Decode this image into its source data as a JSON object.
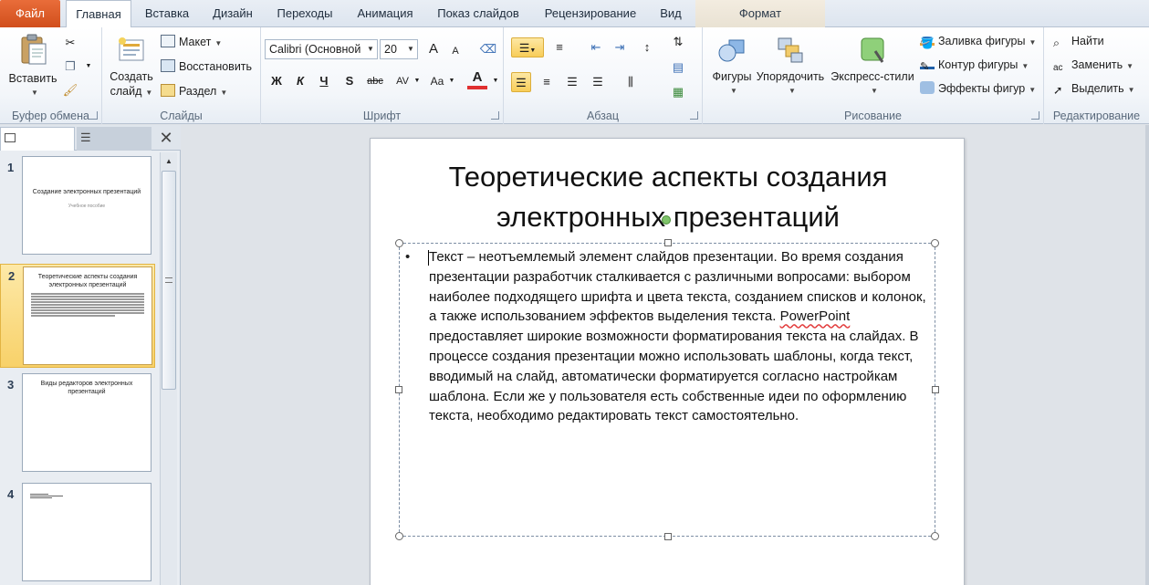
{
  "tabs": {
    "file": "Файл",
    "home": "Главная",
    "insert": "Вставка",
    "design": "Дизайн",
    "transitions": "Переходы",
    "animation": "Анимация",
    "slideshow": "Показ слайдов",
    "review": "Рецензирование",
    "view": "Вид",
    "format": "Формат"
  },
  "clipboard": {
    "paste": "Вставить",
    "group_label": "Буфер обмена"
  },
  "slides_group": {
    "new_slide_line1": "Создать",
    "new_slide_line2": "слайд",
    "layout": "Макет",
    "reset": "Восстановить",
    "section": "Раздел",
    "group_label": "Слайды"
  },
  "font": {
    "name": "Calibri (Основной",
    "size": "20",
    "group_label": "Шрифт",
    "bold": "Ж",
    "italic": "К",
    "underline": "Ч",
    "shadow": "S",
    "strike": "abc",
    "spacing": "AV",
    "case": "Aa",
    "color_letter": "A",
    "grow": "A",
    "shrink": "A"
  },
  "paragraph": {
    "group_label": "Абзац"
  },
  "drawing": {
    "shapes": "Фигуры",
    "arrange": "Упорядочить",
    "quick_styles": "Экспресс-стили",
    "fill": "Заливка фигуры",
    "outline": "Контур фигуры",
    "effects": "Эффекты фигур",
    "group_label": "Рисование"
  },
  "editing": {
    "find": "Найти",
    "replace": "Заменить",
    "select": "Выделить",
    "group_label": "Редактирование"
  },
  "thumbnails": [
    {
      "num": "1",
      "title": "Создание  электронных презентаций",
      "subtitle": "Учебное  пособие"
    },
    {
      "num": "2",
      "title": "Теоретические аспекты создания электронных презентаций"
    },
    {
      "num": "3",
      "title": "Виды редакторов электронных презентаций"
    },
    {
      "num": "4",
      "title": ""
    }
  ],
  "slide": {
    "title": "Теоретические аспекты создания электронных презентаций",
    "text_before": "Текст – неотъемлемый элемент слайдов презентации. Во время создания презентации разработчик сталкивается с различными вопросами: выбором наиболее подходящего шрифта и цвета текста, созданием списков и колонок, а также  использованием эффектов выделения текста. ",
    "text_misspelled": "PowerPoint",
    "text_after": " предоставляет широкие возможности форматирования текста на слайдах. В процессе создания презентации можно использовать шаблоны, когда текст, вводимый на слайд, автоматически форматируется согласно настройкам шаблона. Если же у пользователя есть собственные идеи по оформлению текста, необходимо редактировать текст самостоятельно.",
    "bullet": "•"
  },
  "colors": {
    "file_tab": "#d9582a",
    "selection": "#f8cd58",
    "font_color_bar": "#e03030",
    "rotation_handle": "#7fc46a"
  }
}
